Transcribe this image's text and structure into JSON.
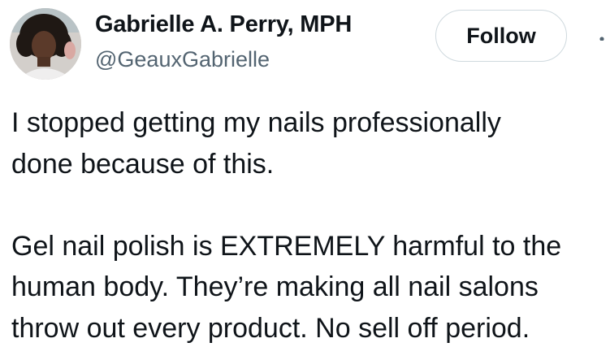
{
  "author": {
    "display_name": "Gabrielle A. Perry, MPH",
    "handle": "@GeauxGabrielle"
  },
  "actions": {
    "follow_label": "Follow"
  },
  "icons": {
    "more": "more-options-icon",
    "avatar": "profile-photo"
  },
  "tweet": {
    "lines": [
      "I stopped getting my nails professionally",
      "done because of this.",
      "Gel nail polish is EXTREMELY harmful to the",
      "human body. They’re making all nail salons",
      "throw out every product. No sell off period."
    ]
  },
  "colors": {
    "text_primary": "#0f1419",
    "text_secondary": "#536471",
    "button_border": "#cfd9de"
  }
}
